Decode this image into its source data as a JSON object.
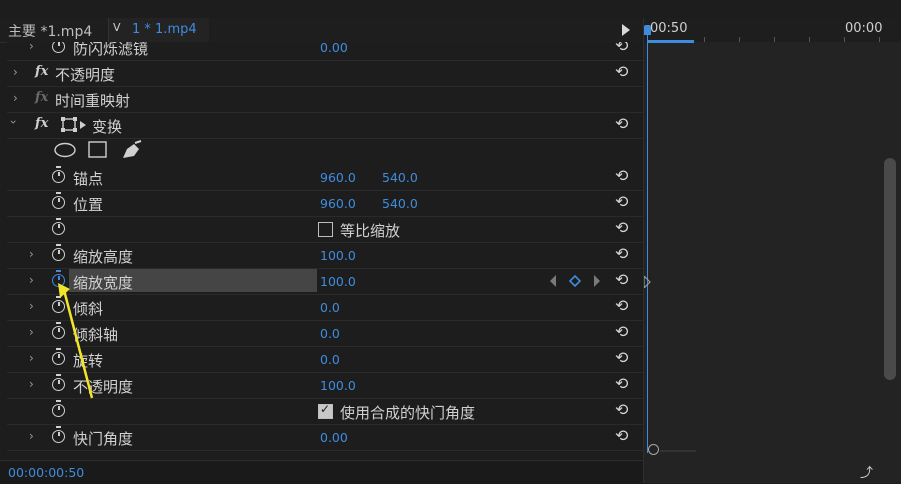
{
  "header": {
    "master_tab": "主要 *1.mp4",
    "clip_chevron": "ᐯ",
    "clip_name": "1 * 1.mp4"
  },
  "effects": {
    "rows": [
      {
        "label": "防闪烁滤镜",
        "value1": "0.00"
      },
      {
        "fx": "fx",
        "label": "不透明度"
      },
      {
        "fx": "fx",
        "label": "时间重映射"
      },
      {
        "fx": "fx",
        "label": "变换"
      },
      {
        "label": "锚点",
        "value1": "960.0",
        "value2": "540.0"
      },
      {
        "label": "位置",
        "value1": "960.0",
        "value2": "540.0"
      },
      {
        "label": "等比缩放",
        "checked": false
      },
      {
        "label": "缩放高度",
        "value1": "100.0"
      },
      {
        "label": "缩放宽度",
        "value1": "100.0"
      },
      {
        "label": "倾斜",
        "value1": "0.0"
      },
      {
        "label": "倾斜轴",
        "value1": "0.0"
      },
      {
        "label": "旋转",
        "value1": "0.0"
      },
      {
        "label": "不透明度",
        "value1": "100.0"
      },
      {
        "label": "使用合成的快门角度",
        "checked": true
      },
      {
        "label": "快门角度",
        "value1": "0.00"
      }
    ]
  },
  "timeline": {
    "time_left": "00:50",
    "time_right": "00:00"
  },
  "footer": {
    "timecode": "00:00:00:50"
  },
  "colors": {
    "accent": "#3f8cde",
    "annotation": "#f3e42a"
  },
  "icons": [
    "expand-arrow-icon",
    "fx-badge-icon",
    "stopwatch-icon",
    "reset-icon",
    "ellipse-mask-icon",
    "rectangle-mask-icon",
    "pen-mask-icon",
    "transform-icon",
    "keyframe-nav-icon",
    "play-icon"
  ]
}
